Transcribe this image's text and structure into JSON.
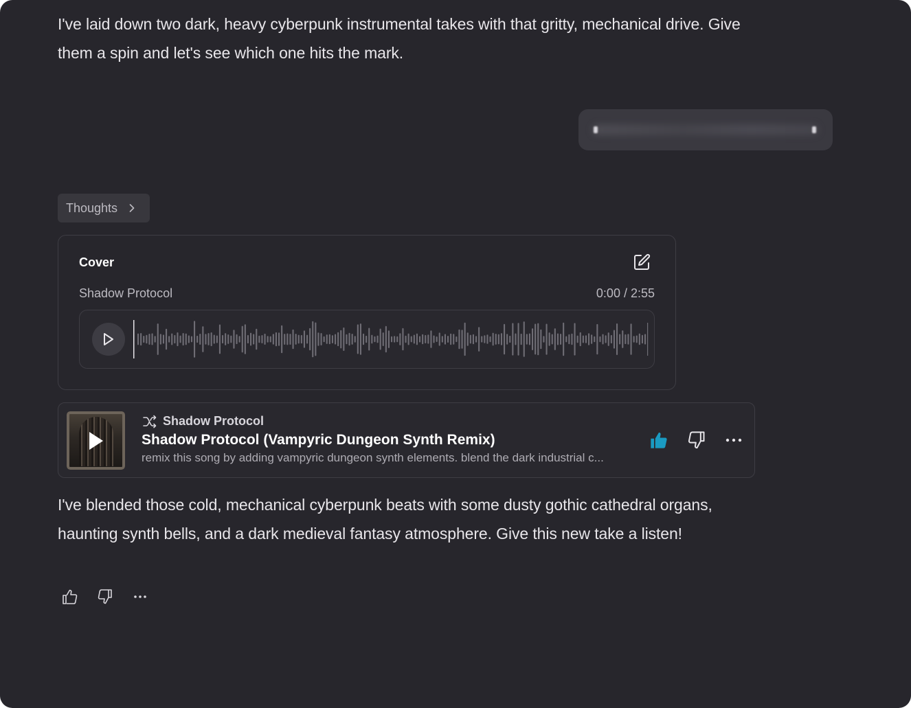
{
  "messages": {
    "intro": "I've laid down two dark, heavy cyberpunk instrumental takes with that gritty, mechanical drive. Give them a spin and let's see which one hits the mark.",
    "outro": "I've blended those cold, mechanical cyberpunk beats with some dusty gothic cathedral organs, haunting synth bells, and a dark medieval fantasy atmosphere. Give this new take a listen!"
  },
  "thoughts": {
    "label": "Thoughts",
    "icon": "chevron-right-icon"
  },
  "cover": {
    "heading": "Cover",
    "song_name": "Shadow Protocol",
    "time": "0:00 / 2:55",
    "progress": 0,
    "edit_icon": "edit-icon",
    "play_icon": "play-icon"
  },
  "track": {
    "source_label": "Shadow Protocol",
    "title": "Shadow Protocol (Vampyric Dungeon Synth Remix)",
    "description": "remix this song by adding vampyric dungeon synth elements. blend the dark industrial c...",
    "liked": true,
    "icons": [
      "shuffle-icon",
      "thumbs-up-icon",
      "thumbs-down-icon",
      "more-icon"
    ]
  },
  "colors": {
    "background": "#27262c",
    "accent_like": "#1a9bc2",
    "text_primary": "#e8e6ea",
    "text_secondary": "#bdbbc2"
  }
}
